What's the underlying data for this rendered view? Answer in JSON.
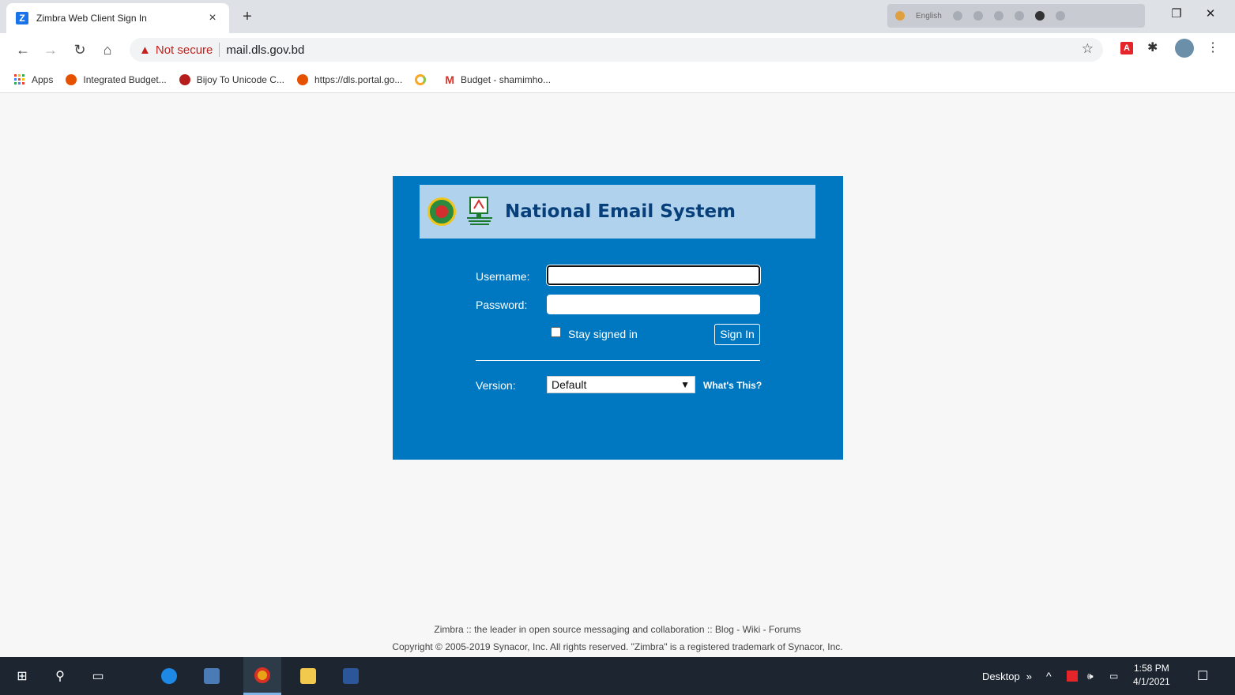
{
  "browser": {
    "tab_title": "Zimbra Web Client Sign In",
    "tab_favicon_letter": "Z",
    "tab_close": "×",
    "new_tab": "+",
    "tray_language": "English",
    "security_label": "Not secure",
    "url": "mail.dls.gov.bd"
  },
  "bookmarks": [
    {
      "label": "Apps",
      "icon": "apps-grid-icon"
    },
    {
      "label": "Integrated Budget...",
      "icon": "budget-favicon",
      "color": "#e65100"
    },
    {
      "label": "Bijoy To Unicode C...",
      "icon": "bijoy-favicon",
      "color": "#b71c1c"
    },
    {
      "label": "https://dls.portal.go...",
      "icon": "portal-favicon",
      "color": "#e65100"
    },
    {
      "label": "",
      "icon": "loading-icon",
      "color": "#f9a825"
    },
    {
      "label": "Budget - shamimho...",
      "icon": "gmail-icon",
      "color": "#d93025"
    }
  ],
  "login": {
    "banner_title": "National Email System",
    "username_label": "Username:",
    "username_value": "",
    "password_label": "Password:",
    "password_value": "",
    "stay_signed_in_label": "Stay signed in",
    "stay_signed_in_checked": false,
    "signin_label": "Sign In",
    "version_label": "Version:",
    "version_selected": "Default",
    "whats_this": "What's This?"
  },
  "footer": {
    "line1": "Zimbra :: the leader in open source messaging and collaboration :: Blog - Wiki - Forums",
    "line2": "Copyright © 2005-2019 Synacor, Inc. All rights reserved. \"Zimbra\" is a registered trademark of Synacor, Inc."
  },
  "taskbar": {
    "desktop_label": "Desktop",
    "time": "1:58 PM",
    "date": "4/1/2021"
  },
  "colors": {
    "card_blue": "#0078c1",
    "banner_light_blue": "#b0d2ec",
    "title_navy": "#073f7a",
    "not_secure_red": "#c5221f"
  }
}
